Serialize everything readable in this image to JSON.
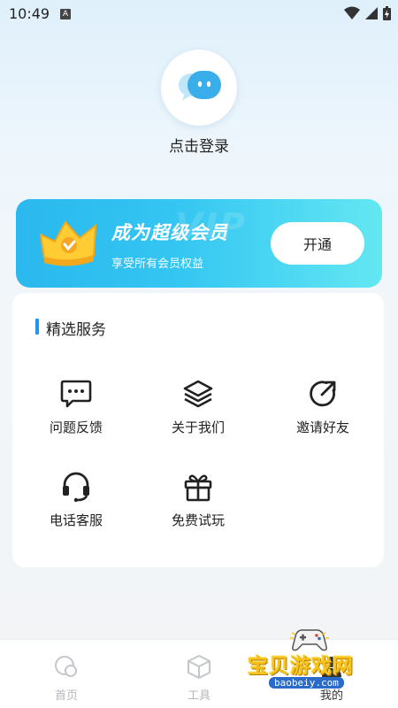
{
  "status_bar": {
    "time": "10:49",
    "notif_glyph": "A"
  },
  "profile": {
    "login_text": "点击登录"
  },
  "vip": {
    "title": "成为超级会员",
    "subtitle": "享受所有会员权益",
    "button_label": "开通",
    "watermark": "VIP",
    "colors": {
      "start": "#2ab8ee",
      "end": "#63e7f2"
    }
  },
  "services": {
    "title": "精选服务",
    "items": [
      {
        "label": "问题反馈",
        "icon": "feedback-icon"
      },
      {
        "label": "关于我们",
        "icon": "layers-icon"
      },
      {
        "label": "邀请好友",
        "icon": "share-icon"
      },
      {
        "label": "电话客服",
        "icon": "headset-icon"
      },
      {
        "label": "免费试玩",
        "icon": "gift-icon"
      }
    ]
  },
  "bottom_nav": {
    "items": [
      {
        "label": "首页",
        "icon": "home-icon",
        "active": false
      },
      {
        "label": "工具",
        "icon": "box-icon",
        "active": false
      },
      {
        "label": "我的",
        "icon": "profile-icon",
        "active": true
      }
    ]
  },
  "watermark": {
    "text": "宝贝游戏网",
    "url": "baobeiy.com"
  }
}
